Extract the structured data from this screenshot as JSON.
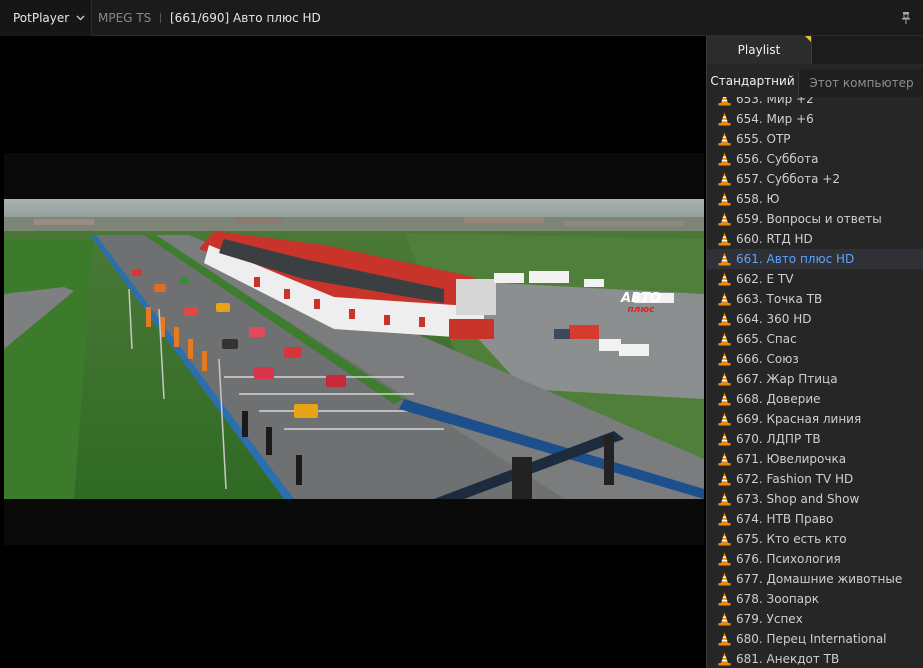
{
  "titlebar": {
    "app_name": "PotPlayer",
    "format": "MPEG TS",
    "title": "[661/690] Авто плюс HD"
  },
  "video": {
    "channel_logo_line1": "АВТО",
    "channel_logo_line2": "плюс"
  },
  "playlist": {
    "tab_label": "Playlist",
    "subtab_standard": "Стандартний",
    "subtab_computer": "Этот компьютер",
    "active_index": 8,
    "items": [
      "653. Мир +2",
      "654. Мир +6",
      "655. ОТР",
      "656. Суббота",
      "657. Суббота +2",
      "658. Ю",
      "659. Вопросы и ответы",
      "660. RTД HD",
      "661. Авто плюс HD",
      "662. E TV",
      "663. Точка ТВ",
      "664. 360 HD",
      "665. Спас",
      "666. Союз",
      "667. Жар Птица",
      "668. Доверие",
      "669. Красная линия",
      "670. ЛДПР ТВ",
      "671. Ювелирочка",
      "672. Fashion TV HD",
      "673. Shop and Show",
      "674. НТВ Право",
      "675. Кто есть кто",
      "676. Психология",
      "677. Домашние животные",
      "678. Зоопарк",
      "679. Успех",
      "680. Перец International",
      "681. Анекдот ТВ"
    ]
  },
  "colors": {
    "active_item": "#5ea2ff",
    "cone_orange": "#f08a00",
    "tab_marker": "#e8c23a"
  }
}
